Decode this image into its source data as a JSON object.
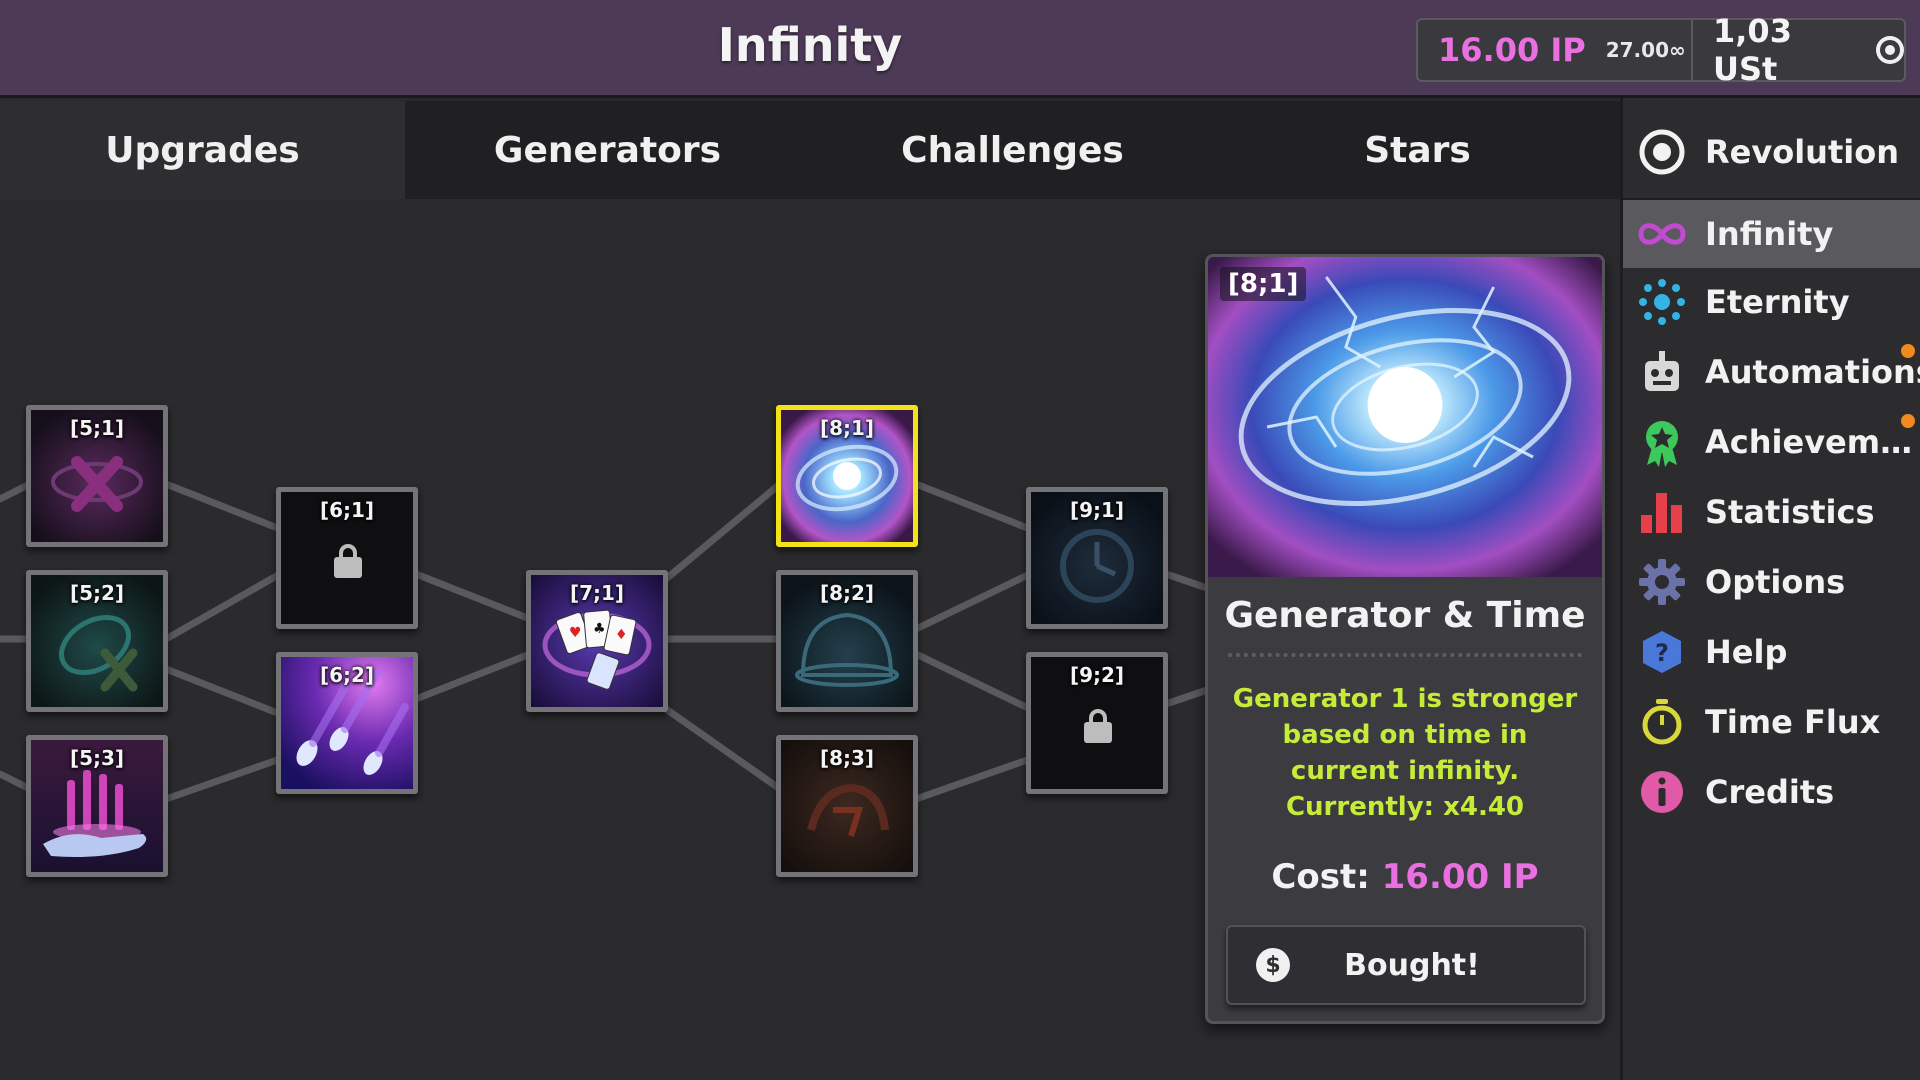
{
  "header": {
    "title": "Infinity",
    "ip_amount": "16.00 IP",
    "infinities": "27.00∞",
    "ust": "1,03 USt"
  },
  "tabs": [
    {
      "label": "Upgrades",
      "active": true
    },
    {
      "label": "Generators",
      "active": false
    },
    {
      "label": "Challenges",
      "active": false
    },
    {
      "label": "Stars",
      "active": false
    }
  ],
  "upgrades": [
    {
      "id": "[5;1]",
      "state": "available",
      "art": "purple-x"
    },
    {
      "id": "[5;2]",
      "state": "available",
      "art": "teal-x"
    },
    {
      "id": "[5;3]",
      "state": "bought",
      "art": "hand-crystals"
    },
    {
      "id": "[6;1]",
      "state": "locked",
      "art": "lock"
    },
    {
      "id": "[6;2]",
      "state": "bought",
      "art": "comets"
    },
    {
      "id": "[7;1]",
      "state": "bought",
      "art": "cards"
    },
    {
      "id": "[8;1]",
      "state": "selected",
      "art": "galaxy"
    },
    {
      "id": "[8;2]",
      "state": "available",
      "art": "dome"
    },
    {
      "id": "[8;3]",
      "state": "available",
      "art": "red-glyph"
    },
    {
      "id": "[9;1]",
      "state": "available",
      "art": "clock"
    },
    {
      "id": "[9;2]",
      "state": "locked",
      "art": "lock"
    }
  ],
  "detail": {
    "id": "[8;1]",
    "name": "Generator & Time",
    "description": "Generator 1 is stronger based on time in current infinity. Currently: x4.40",
    "cost_label": "Cost:",
    "cost_value": "16.00 IP",
    "button_label": "Bought!",
    "button_icon": "$"
  },
  "sidebar": {
    "items": [
      {
        "label": "Revolution",
        "icon": "revolution-icon",
        "active": false,
        "notification": false
      },
      {
        "label": "Infinity",
        "icon": "infinity-icon",
        "active": true,
        "notification": false
      },
      {
        "label": "Eternity",
        "icon": "eternity-icon",
        "active": false,
        "notification": false
      },
      {
        "label": "Automations",
        "icon": "robot-icon",
        "active": false,
        "notification": true
      },
      {
        "label": "Achievem…",
        "icon": "ribbon-icon",
        "active": false,
        "notification": true
      },
      {
        "label": "Statistics",
        "icon": "bar-chart-icon",
        "active": false,
        "notification": false
      },
      {
        "label": "Options",
        "icon": "gear-icon",
        "active": false,
        "notification": false
      },
      {
        "label": "Help",
        "icon": "help-icon",
        "active": false,
        "notification": false
      },
      {
        "label": "Time Flux",
        "icon": "stopwatch-icon",
        "active": false,
        "notification": false
      },
      {
        "label": "Credits",
        "icon": "info-icon",
        "active": false,
        "notification": false
      }
    ]
  },
  "colors": {
    "topbar": "#4d3a57",
    "ip": "#e970e0",
    "description": "#c6ec3a",
    "selected_border": "#f2e21a",
    "notification": "#f08a1e"
  }
}
